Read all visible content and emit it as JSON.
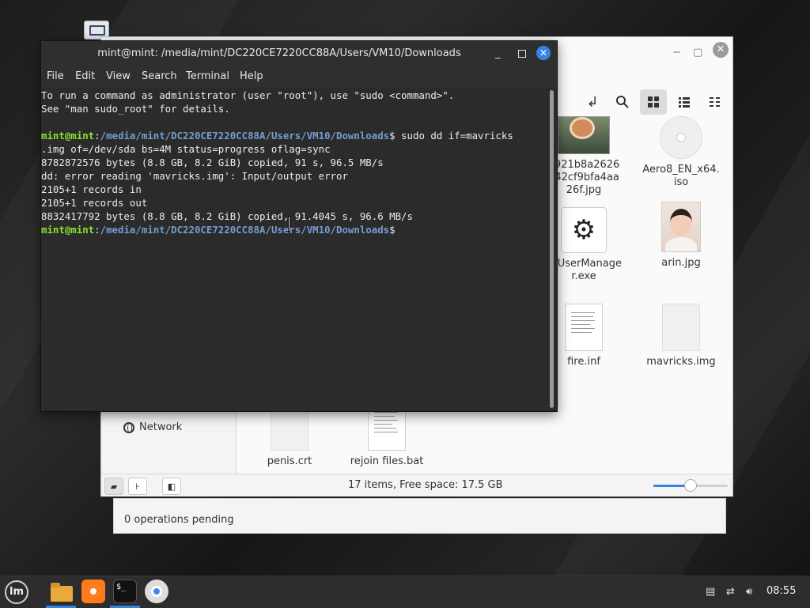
{
  "desktop": {
    "icon": "computer-icon"
  },
  "ops_panel": {
    "text": "0 operations pending"
  },
  "file_manager": {
    "window_controls": {
      "minimize": "−",
      "maximize": "▢",
      "close": "✕"
    },
    "toolbar": {
      "icons": [
        "open-terminal-icon",
        "search-icon",
        "grid-view-icon",
        "list-view-icon",
        "compact-view-icon"
      ]
    },
    "sidebar": {
      "items": [
        {
          "label": "Network",
          "icon": "network-icon"
        }
      ]
    },
    "files": [
      {
        "name": "5921b8a2626d42cf9bfa4aa26f.jpg",
        "lines": [
          "5921b8a2626",
          "d42cf9bfa4aa",
          "26f.jpg"
        ],
        "icon": "image-thumbnail"
      },
      {
        "name": "Aero8_EN_x64.iso",
        "lines": [
          "Aero8_EN_x64.",
          "iso"
        ],
        "icon": "disc-icon"
      },
      {
        "name": "ckUserManager.exe",
        "lines": [
          "ckUserManage",
          "r.exe"
        ],
        "icon": "gear-icon"
      },
      {
        "name": "arin.jpg",
        "lines": [
          "arin.jpg"
        ],
        "icon": "image-thumbnail"
      },
      {
        "name": "fire.inf",
        "lines": [
          "fire.inf"
        ],
        "icon": "text-file-icon"
      },
      {
        "name": "mavricks.img",
        "lines": [
          "mavricks.img"
        ],
        "icon": "blank-file-icon"
      },
      {
        "name": "penis.crt",
        "lines": [
          "penis.crt"
        ],
        "icon": "blank-file-icon"
      },
      {
        "name": "rejoin files.bat",
        "lines": [
          "rejoin files.bat"
        ],
        "icon": "text-file-icon"
      }
    ],
    "statusbar": {
      "text": "17 items, Free space: 17.5 GB",
      "zoom_level": 0.5
    }
  },
  "terminal": {
    "title": "mint@mint: /media/mint/DC220CE7220CC88A/Users/VM10/Downloads",
    "menu": [
      "File",
      "Edit",
      "View",
      "Search",
      "Terminal",
      "Help"
    ],
    "lines": {
      "l1": "To run a command as administrator (user \"root\"), use \"sudo <command>\".",
      "l2": "See \"man sudo_root\" for details.",
      "prompt_user": "mint@mint",
      "prompt_sep": ":",
      "prompt_path": "/media/mint/DC220CE7220CC88A/Users/VM10/Downloads",
      "cmd1": "$ sudo dd if=mavricks",
      "cmd1_wrap": ".img of=/dev/sda bs=4M status=progress oflag=sync",
      "l5": "8782872576 bytes (8.8 GB, 8.2 GiB) copied, 91 s, 96.5 MB/s",
      "l6": "dd: error reading 'mavricks.img': Input/output error",
      "l7": "2105+1 records in",
      "l8": "2105+1 records out",
      "l9": "8832417792 bytes (8.8 GB, 8.2 GiB) copied, 91.4045 s, 96.6 MB/s",
      "prompt_end": "$"
    }
  },
  "taskbar": {
    "menu_logo": "lm",
    "apps": [
      "file-manager-icon",
      "firefox-icon",
      "terminal-icon",
      "chromium-icon"
    ],
    "terminal_icon_text": "$_",
    "tray_icons": [
      "clipboard-icon",
      "network-icon",
      "volume-icon"
    ],
    "clock": "08:55"
  }
}
